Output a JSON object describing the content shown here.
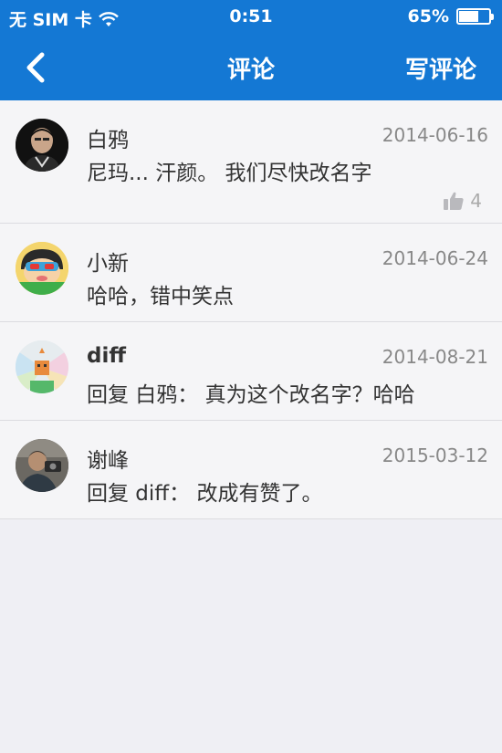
{
  "status": {
    "carrier": "无 SIM 卡",
    "time": "0:51",
    "battery": "65%",
    "battery_level": 0.65
  },
  "nav": {
    "title": "评论",
    "action": "写评论"
  },
  "comments": [
    {
      "name": "白鸦",
      "date": "2014-06-16",
      "text": "尼玛... 汗颜。 我们尽快改名字",
      "likes": "4"
    },
    {
      "name": "小新",
      "date": "2014-06-24",
      "text": "哈哈，错中笑点"
    },
    {
      "name": "diff",
      "date": "2014-08-21",
      "text": "回复 白鸦： 真为这个改名字？哈哈"
    },
    {
      "name": "谢峰",
      "date": "2015-03-12",
      "text": "回复 diff： 改成有赞了。"
    }
  ],
  "colors": {
    "accent": "#1478d4",
    "background": "#efeff4"
  }
}
